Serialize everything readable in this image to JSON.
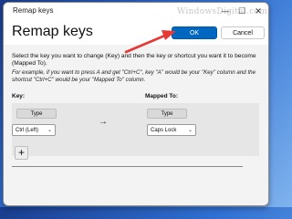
{
  "window": {
    "title": "Remap keys",
    "watermark": "WindowsDigital.com",
    "minimize_glyph": "—",
    "maximize_glyph": "☐",
    "close_glyph": "✕"
  },
  "header": {
    "title": "Remap keys",
    "ok_label": "OK",
    "cancel_label": "Cancel"
  },
  "instructions": "Select the key you want to change (Key) and then the key or shortcut you want it to become (Mapped To).",
  "example": "For example, if you want to press A and get \"Ctrl+C\", key \"A\" would be your \"Key\" column and the shortcut \"Ctrl+C\" would be your \"Mapped To\" column.",
  "columns": {
    "key_label": "Key:",
    "mapped_label": "Mapped To:"
  },
  "row": {
    "type_label": "Type",
    "key_value": "Ctrl (Left)",
    "mapped_type_label": "Type",
    "mapped_value": "Caps Lock",
    "arrow_glyph": "→"
  },
  "add_glyph": "+",
  "colors": {
    "accent": "#0067c0",
    "annotation_arrow": "#e53935"
  },
  "icons": {
    "row_arrow": "right-arrow-icon",
    "add": "plus-icon",
    "dropdown": "chevron-down-icon"
  }
}
